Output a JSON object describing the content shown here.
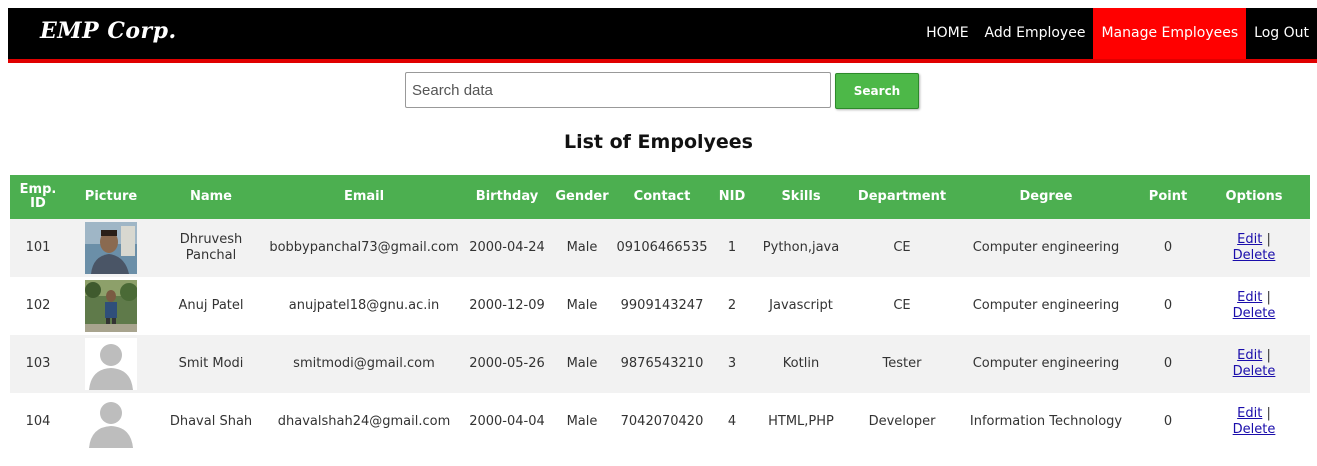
{
  "header": {
    "logo": "EMP Corp.",
    "nav": [
      {
        "label": "HOME",
        "active": false
      },
      {
        "label": "Add Employee",
        "active": false
      },
      {
        "label": "Manage Employees",
        "active": true
      },
      {
        "label": "Log Out",
        "active": false
      }
    ]
  },
  "search": {
    "placeholder": "Search data",
    "value": "",
    "button_label": "Search"
  },
  "page_title": "List of Empolyees",
  "table": {
    "columns": [
      "Emp. ID",
      "Picture",
      "Name",
      "Email",
      "Birthday",
      "Gender",
      "Contact",
      "NID",
      "Skills",
      "Department",
      "Degree",
      "Point",
      "Options"
    ],
    "rows": [
      {
        "id": "101",
        "picture": "photo-icon",
        "name": "Dhruvesh Panchal",
        "email": "bobbypanchal73@gmail.com",
        "birthday": "2000-04-24",
        "gender": "Male",
        "contact": "09106466535",
        "nid": "1",
        "skills": "Python,java",
        "department": "CE",
        "degree": "Computer engineering",
        "point": "0",
        "edit": "Edit",
        "sep": " |",
        "delete": "Delete"
      },
      {
        "id": "102",
        "picture": "photo-icon",
        "name": "Anuj Patel",
        "email": "anujpatel18@gnu.ac.in",
        "birthday": "2000-12-09",
        "gender": "Male",
        "contact": "9909143247",
        "nid": "2",
        "skills": "Javascript",
        "department": "CE",
        "degree": "Computer engineering",
        "point": "0",
        "edit": "Edit",
        "sep": " |",
        "delete": "Delete"
      },
      {
        "id": "103",
        "picture": "avatar-placeholder-icon",
        "name": "Smit Modi",
        "email": "smitmodi@gmail.com",
        "birthday": "2000-05-26",
        "gender": "Male",
        "contact": "9876543210",
        "nid": "3",
        "skills": "Kotlin",
        "department": "Tester",
        "degree": "Computer engineering",
        "point": "0",
        "edit": "Edit",
        "sep": " |",
        "delete": "Delete"
      },
      {
        "id": "104",
        "picture": "avatar-placeholder-icon",
        "name": "Dhaval Shah",
        "email": "dhavalshah24@gmail.com",
        "birthday": "2000-04-04",
        "gender": "Male",
        "contact": "7042070420",
        "nid": "4",
        "skills": "HTML,PHP",
        "department": "Developer",
        "degree": "Information Technology",
        "point": "0",
        "edit": "Edit",
        "sep": " |",
        "delete": "Delete"
      }
    ]
  },
  "colors": {
    "topbar": "#000000",
    "accent_red": "#ff0000",
    "table_header": "#4caf50",
    "search_button": "#4db848",
    "link": "#1a0dab"
  }
}
